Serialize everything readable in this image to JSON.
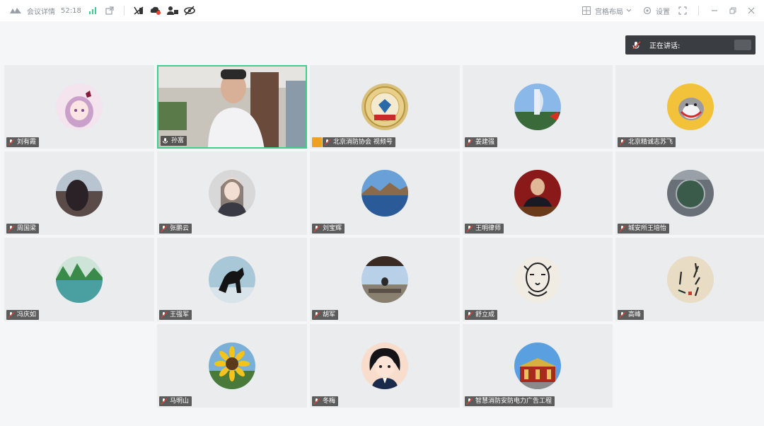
{
  "titlebar": {
    "meeting_details_label": "会议详情",
    "timer": "52:18",
    "layout_label": "宫格布局",
    "settings_label": "设置"
  },
  "speaking": {
    "label": "正在讲话:"
  },
  "participants": [
    {
      "name": "刘有霞"
    },
    {
      "name": "孙富"
    },
    {
      "name": "北京消防协会 视频号"
    },
    {
      "name": "姜建强"
    },
    {
      "name": "北京精诚志苏飞"
    },
    {
      "name": "周国梁"
    },
    {
      "name": "张鹏云"
    },
    {
      "name": "刘宝辉"
    },
    {
      "name": "王明律师"
    },
    {
      "name": "城安所王培怡"
    },
    {
      "name": "冯庆如"
    },
    {
      "name": "王强军"
    },
    {
      "name": "胡军"
    },
    {
      "name": "舒立成"
    },
    {
      "name": "高峰"
    },
    {
      "name": "马明山"
    },
    {
      "name": "冬梅"
    },
    {
      "name": "智慧消防安防电力广告工程"
    }
  ],
  "colors": {
    "active_border": "#3dcf8e",
    "host_badge": "#f0a020",
    "speaking_bg": "#3a3d42"
  }
}
